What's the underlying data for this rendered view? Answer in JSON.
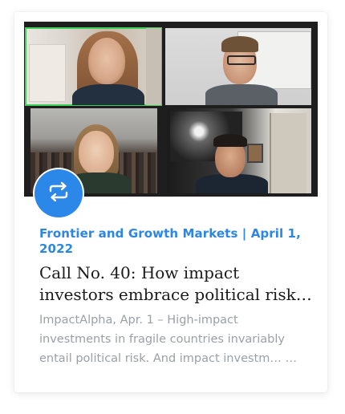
{
  "card": {
    "category_line1": "Frontier and Growth Markets | April 1,",
    "category_line2": "2022",
    "title_line1": "Call No. 40: How impact",
    "title_line2": "investors embrace political risk…",
    "excerpt_line1": "ImpactAlpha, Apr. 1 – High-impact",
    "excerpt_line2": "investments in fragile countries invariably",
    "excerpt_line3": "entail political risk. And impact investm… …",
    "repost_icon": "repost-icon",
    "accent_color": "#2c88e8"
  }
}
